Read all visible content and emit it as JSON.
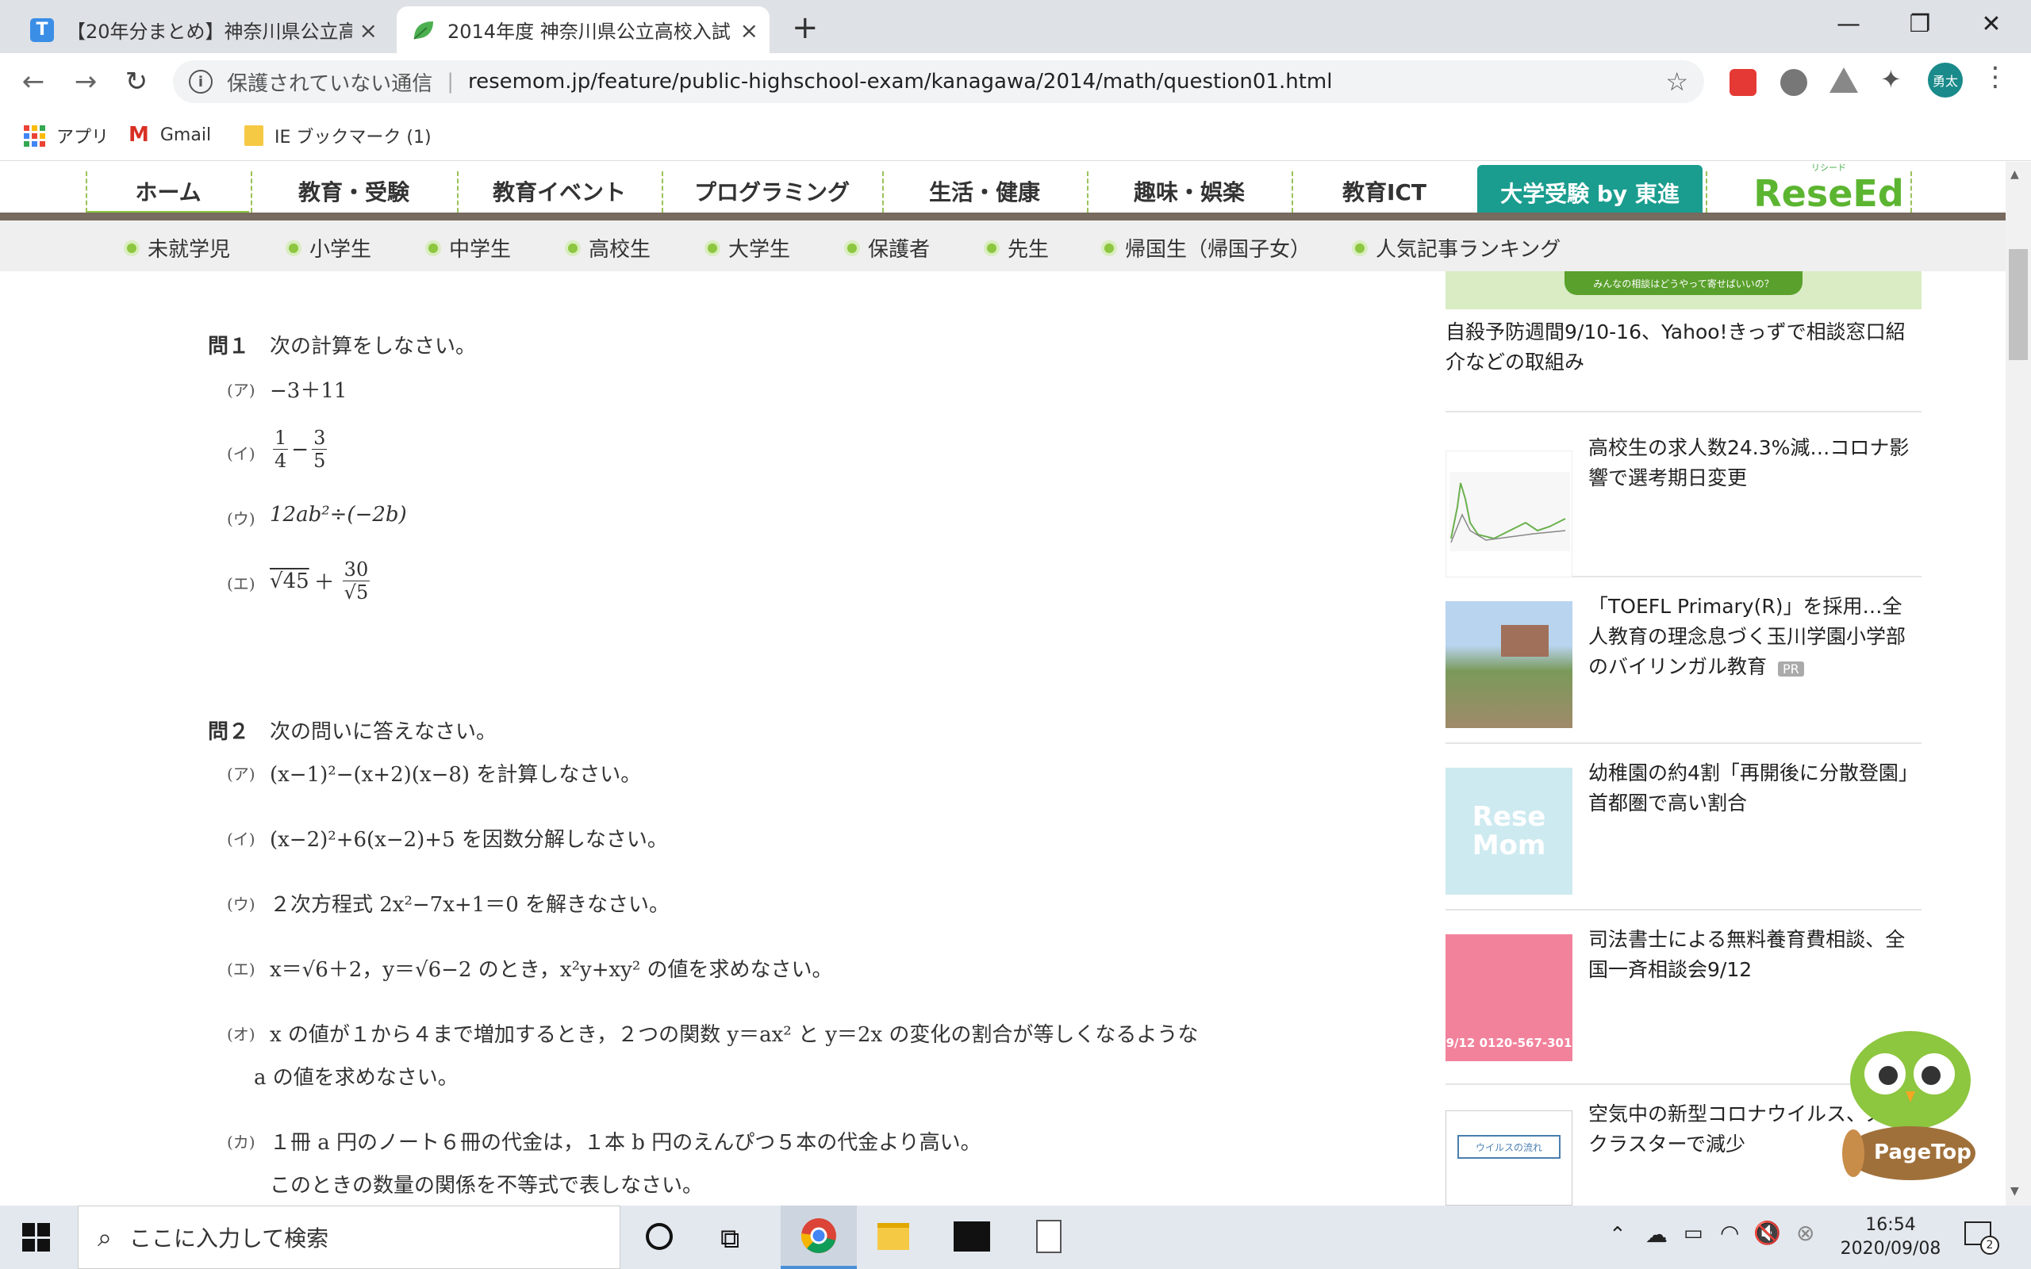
{
  "browser": {
    "tabs": [
      {
        "title": "【20年分まとめ】神奈川県公立高校",
        "favicon_letter": "T",
        "active": false
      },
      {
        "title": "2014年度 神奈川県公立高校入試",
        "favicon_letter": "",
        "active": true
      }
    ],
    "new_tab": "+",
    "window_controls": {
      "minimize": "—",
      "restore": "❐",
      "close": "✕"
    },
    "security_text": "保護されていない通信",
    "url": "resemom.jp/feature/public-highschool-exam/kanagawa/2014/math/question01.html",
    "profile_initials": "勇太",
    "bookmarks": [
      {
        "label": "アプリ",
        "icon": "apps-grid-icon"
      },
      {
        "label": "Gmail",
        "icon": "gmail-icon"
      },
      {
        "label": "IE ブックマーク (1)",
        "icon": "folder-icon"
      }
    ]
  },
  "site": {
    "nav": [
      "ホーム",
      "教育・受験",
      "教育イベント",
      "プログラミング",
      "生活・健康",
      "趣味・娯楽",
      "教育ICT",
      "大学受験 by 東進"
    ],
    "logo_text": "ReseEd",
    "logo_ruby": "リシード",
    "subnav": [
      "未就学児",
      "小学生",
      "中学生",
      "高校生",
      "大学生",
      "保護者",
      "先生",
      "帰国生（帰国子女）",
      "人気記事ランキング"
    ]
  },
  "exam": {
    "q1": {
      "heading": "問１",
      "instruction": "次の計算をしなさい。",
      "a_label": "(ア)",
      "a": "−3＋11",
      "b_label": "(イ)",
      "b_num1": "1",
      "b_den1": "4",
      "b_op": "−",
      "b_num2": "3",
      "b_den2": "5",
      "c_label": "(ウ)",
      "c": "12ab²÷(−2b)",
      "d_label": "(エ)",
      "d_root": "√45",
      "d_op": "＋",
      "d_num": "30",
      "d_den": "√5"
    },
    "q2": {
      "heading": "問２",
      "instruction": "次の問いに答えなさい。",
      "items": [
        {
          "label": "(ア)",
          "text": "(x−1)²−(x+2)(x−8) を計算しなさい。"
        },
        {
          "label": "(イ)",
          "text": "(x−2)²+6(x−2)+5 を因数分解しなさい。"
        },
        {
          "label": "(ウ)",
          "text": "２次方程式 2x²−7x+1＝0 を解きなさい。"
        },
        {
          "label": "(エ)",
          "text": "x＝√6＋2，y＝√6−2 のとき，x²y+xy² の値を求めなさい。"
        },
        {
          "label": "(オ)",
          "text": "x の値が１から４まで増加するとき，２つの関数 y＝ax² と y＝2x の変化の割合が等しくなるような",
          "text2": "a の値を求めなさい。"
        },
        {
          "label": "(カ)",
          "text": "１冊 a 円のノート６冊の代金は，１本 b 円のえんぴつ５本の代金より高い。",
          "text2": "このときの数量の関係を不等式で表しなさい。"
        }
      ]
    }
  },
  "sidebar": {
    "banner_text": "みんなの相談はどうやって寄せばいいの？",
    "articles": [
      {
        "title": "自殺予防週間9/10-16、Yahoo!きっずで相談窓口紹介などの取組み"
      },
      {
        "title": "高校生の求人数24.3%減…コロナ影響で選考期日変更"
      },
      {
        "title": "「TOEFL Primary(R)」を採用…全人教育の理念息づく玉川学園小学部のバイリンガル教育",
        "badge": "PR"
      },
      {
        "title": "幼稚園の約4割「再開後に分散登園」首都圏で高い割合",
        "thumb_text": "Rese Mom"
      },
      {
        "title": "司法書士による無料養育費相談、全国一斉相談会9/12",
        "thumb_text": "9/12 0120-567-301"
      },
      {
        "title": "空気中の新型コロナウイルス、ズマクラスターで減少",
        "thumb_text": "ウイルスの流れ"
      }
    ],
    "pagetop": "PageTop"
  },
  "taskbar": {
    "search_placeholder": "ここに入力して検索",
    "time": "16:54",
    "date": "2020/09/08",
    "notification_count": "2"
  }
}
